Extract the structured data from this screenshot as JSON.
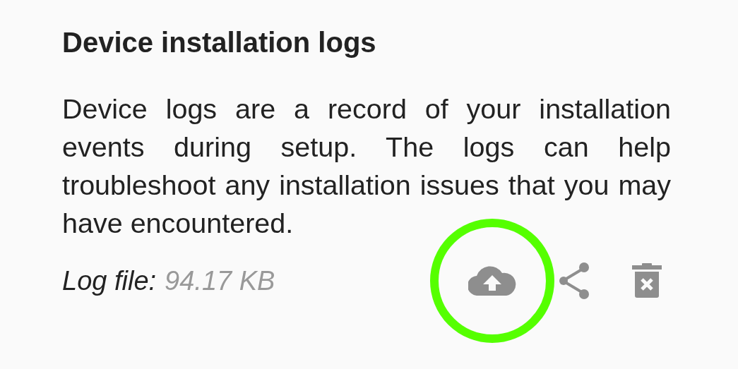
{
  "title": "Device installation logs",
  "description": "Device logs are a record of your installation events during setup. The logs can help troubleshoot any installation issues that you may have encountered.",
  "log_file": {
    "label": "Log file:",
    "size": "94.17 KB"
  },
  "actions": [
    {
      "kind": "upload",
      "highlighted": true
    },
    {
      "kind": "share",
      "highlighted": false
    },
    {
      "kind": "delete",
      "highlighted": false
    }
  ]
}
